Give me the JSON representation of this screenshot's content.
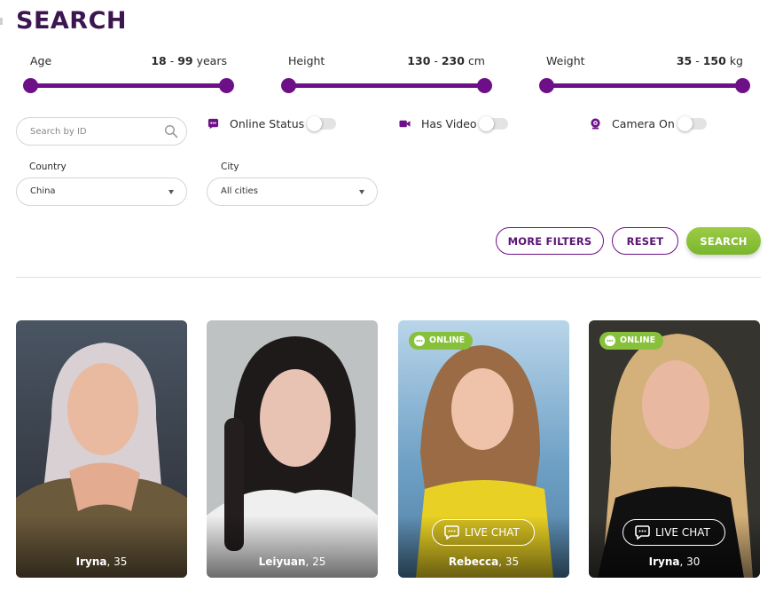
{
  "header": {
    "title": "SEARCH"
  },
  "ranges": [
    {
      "label": "Age",
      "min": "18",
      "max": "99",
      "unit": "years"
    },
    {
      "label": "Height",
      "min": "130",
      "max": "230",
      "unit": "cm"
    },
    {
      "label": "Weight",
      "min": "35",
      "max": "150",
      "unit": "kg"
    }
  ],
  "search": {
    "placeholder": "Search by ID"
  },
  "toggles": {
    "online": {
      "label": "Online Status",
      "icon": "chat-bubble-icon",
      "on": false
    },
    "video": {
      "label": "Has Video",
      "icon": "video-camera-icon",
      "on": false
    },
    "camera": {
      "label": "Camera On",
      "icon": "webcam-icon",
      "on": false
    }
  },
  "country": {
    "label": "Country",
    "value": "China"
  },
  "city": {
    "label": "City",
    "value": "All cities"
  },
  "buttons": {
    "more_filters": "MORE FILTERS",
    "reset": "RESET",
    "search": "SEARCH"
  },
  "profiles": [
    {
      "name": "Iryna",
      "age": "35",
      "online": false,
      "live_chat": false
    },
    {
      "name": "Leiyuan",
      "age": "25",
      "online": false,
      "live_chat": false
    },
    {
      "name": "Rebecca",
      "age": "35",
      "online": true,
      "live_chat": true,
      "badge": "ONLINE",
      "chat_label": "LIVE CHAT"
    },
    {
      "name": "Iryna",
      "age": "30",
      "online": true,
      "live_chat": true,
      "badge": "ONLINE",
      "chat_label": "LIVE CHAT"
    }
  ],
  "colors": {
    "accent": "#6d1088",
    "title": "#3c1650",
    "green": "#87c13c",
    "border": "#d5d5d5"
  }
}
